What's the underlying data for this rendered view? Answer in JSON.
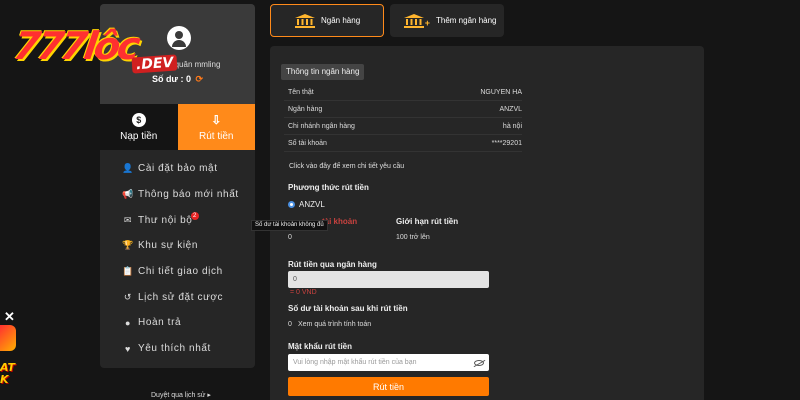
{
  "logo": {
    "main": "777lôc",
    "suffix": ".DEV"
  },
  "profile": {
    "username": "quân mmling",
    "balance_label": "Số dư :",
    "balance_value": "0",
    "refresh_icon": "refresh-icon"
  },
  "actions": {
    "deposit": "Nạp tiền",
    "withdraw": "Rút tiền"
  },
  "menu": [
    {
      "label": "Cài đặt bảo mật",
      "icon": "user-shield-icon",
      "glyph": "👤"
    },
    {
      "label": "Thông báo mới nhất",
      "icon": "megaphone-icon",
      "glyph": "📢"
    },
    {
      "label": "Thư nội bộ",
      "icon": "envelope-icon",
      "glyph": "✉",
      "badge": "2"
    },
    {
      "label": "Khu sự kiện",
      "icon": "trophy-icon",
      "glyph": "🏆"
    },
    {
      "label": "Chi tiết giao dịch",
      "icon": "clipboard-icon",
      "glyph": "📋"
    },
    {
      "label": "Lịch sử đặt cược",
      "icon": "history-icon",
      "glyph": "↺"
    },
    {
      "label": "Hoàn trả",
      "icon": "dollar-coin-icon",
      "glyph": "●"
    },
    {
      "label": "Yêu thích nhất",
      "icon": "heart-icon",
      "glyph": "♥"
    }
  ],
  "history_link": "Duyệt qua lịch sử ▸",
  "tabs": {
    "bank": "Ngân hàng",
    "add_bank": "Thêm ngân hàng"
  },
  "info": {
    "title": "Thông tin ngân hàng",
    "rows": [
      {
        "label": "Tên thật",
        "value": "NGUYEN HA"
      },
      {
        "label": "Ngân hàng",
        "value": "ANZVL"
      },
      {
        "label": "Chi nhánh ngân hàng",
        "value": "hà nội"
      },
      {
        "label": "Số tài khoản",
        "value": "****29201"
      }
    ],
    "detail_link": "Click vào đây để xem chi tiết yêu cầu"
  },
  "withdraw": {
    "method_label": "Phương thức rút tiền",
    "method_value": "ANZVL",
    "account_label": "tài khoản",
    "account_value": "0",
    "limit_label": "Giới hạn rút tiền",
    "limit_value": "100 trở lên",
    "amount_label": "Rút tiền qua ngân hàng",
    "amount_value": "0",
    "amount_unit": "= 0 VND",
    "after_label": "Số dư tài khoản sau khi rút tiền",
    "after_value": "0",
    "after_link": "Xem quá trình tính toán",
    "password_label": "Mật khẩu rút tiền",
    "password_placeholder": "Vui lòng nhập mật khẩu rút tiền của bạn",
    "submit": "Rút tiền"
  },
  "tooltip": "Số dư tài khoản không đủ",
  "edge_text": "AT\nK"
}
